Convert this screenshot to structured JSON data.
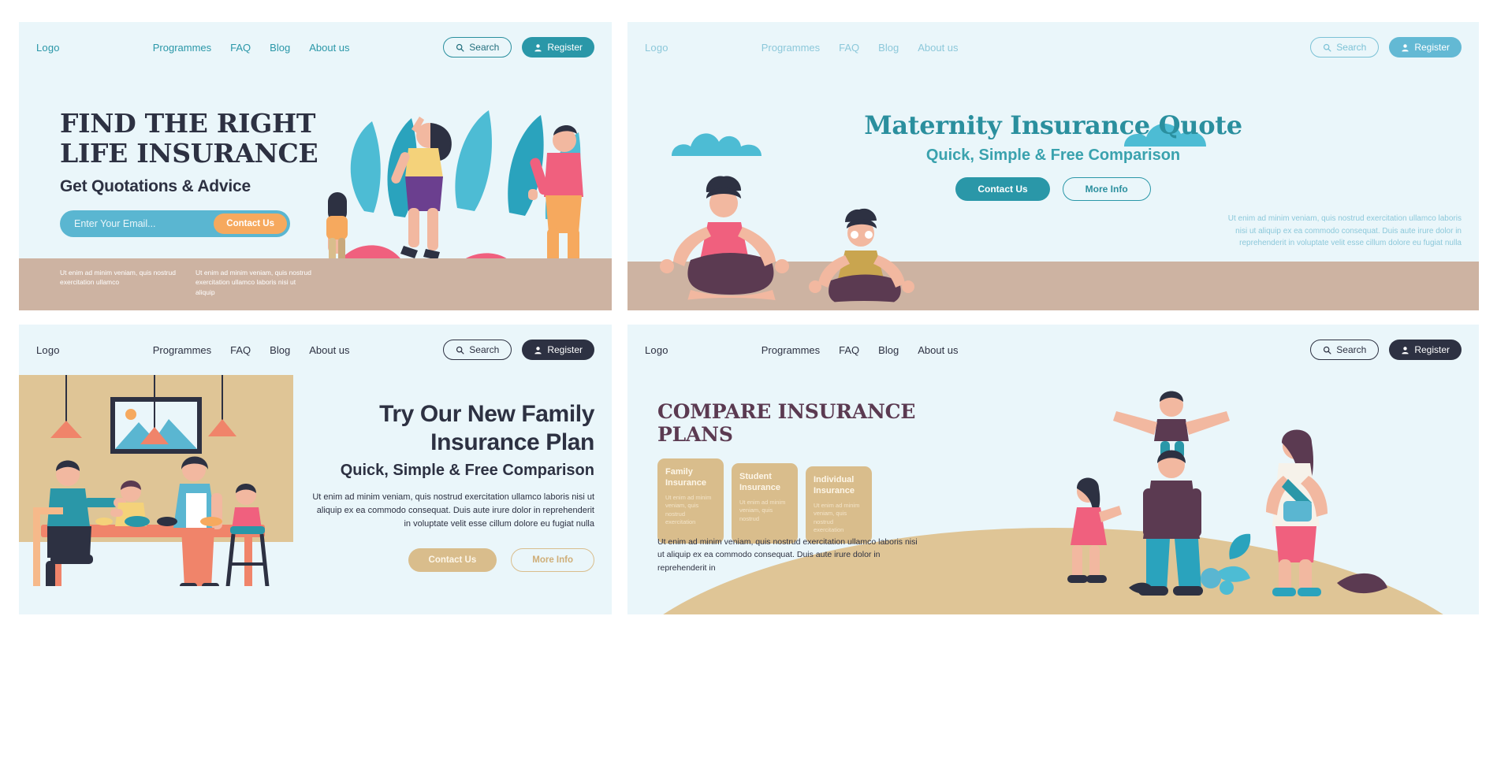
{
  "nav": {
    "logo": "Logo",
    "links": [
      "Programmes",
      "FAQ",
      "Blog",
      "About us"
    ],
    "search_label": "Search",
    "register_label": "Register",
    "search_icon": "search-icon",
    "user_icon": "user-icon"
  },
  "colors": {
    "page_bg": "#ffffff",
    "panel_bg": "#eaf6fa",
    "teal": "#2a97a8",
    "teal_dark": "#2a8f9e",
    "teal_faded": "#8cc8da",
    "navy": "#2d3142",
    "sand": "#d9bd8c",
    "sand_dark": "#dfc596",
    "ground_brown": "#cdb3a2",
    "orange": "#f6a95e",
    "plum": "#5b3a51",
    "input_blue": "#5ab6d1"
  },
  "panel1": {
    "title_line1": "Find The Right",
    "title_line2": "Life Insurance",
    "subtitle": "Get Quotations & Advice",
    "email_placeholder": "Enter Your Email...",
    "cta_label": "Contact Us",
    "footer_col1": "Ut enim ad minim veniam, quis nostrud exercitation ullamco",
    "footer_col2": "Ut enim ad minim veniam, quis nostrud exercitation ullamco laboris nisi ut aliquip"
  },
  "panel2": {
    "title": "Maternity Insurance Quote",
    "subtitle": "Quick, Simple & Free Comparison",
    "primary_label": "Contact Us",
    "secondary_label": "More Info",
    "body": "Ut enim ad minim veniam, quis nostrud exercitation ullamco laboris nisi ut aliquip ex ea commodo consequat. Duis aute irure dolor in reprehenderit in voluptate velit esse cillum dolore eu fugiat nulla"
  },
  "panel3": {
    "title_line1": "Try Our New Family",
    "title_line2": "Insurance Plan",
    "subtitle": "Quick, Simple & Free Comparison",
    "body": "Ut enim ad minim veniam, quis nostrud exercitation ullamco laboris nisi ut aliquip ex ea commodo consequat. Duis aute irure dolor in reprehenderit in voluptate velit esse cillum dolore eu fugiat nulla",
    "primary_label": "Contact Us",
    "secondary_label": "More Info"
  },
  "panel4": {
    "title": "Compare Insurance Plans",
    "cards": [
      {
        "title": "Family Insurance",
        "body": "Ut enim ad minim veniam, quis nostrud exercitation"
      },
      {
        "title": "Student Insurance",
        "body": "Ut enim ad minim veniam, quis nostrud"
      },
      {
        "title": "Individual Insurance",
        "body": "Ut enim ad minim veniam, quis nostrud exercitation"
      }
    ],
    "body": "Ut enim ad minim veniam, quis nostrud exercitation ullamco laboris nisi ut aliquip ex ea commodo consequat. Duis aute irure dolor in reprehenderit in"
  }
}
